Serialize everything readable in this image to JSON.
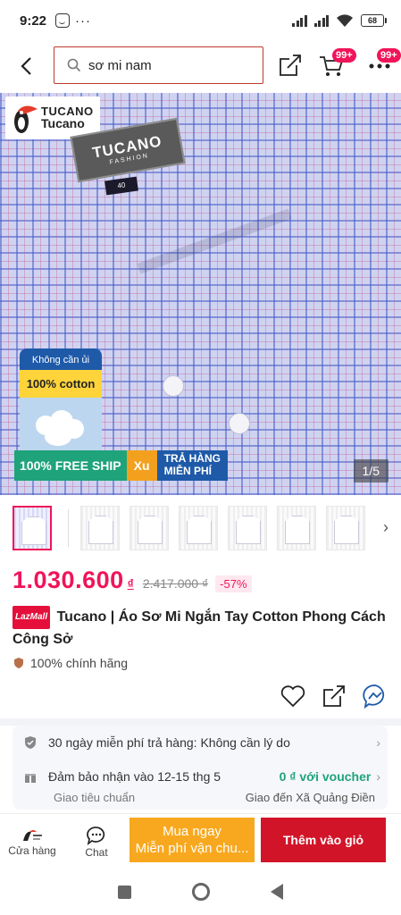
{
  "status": {
    "time": "9:22",
    "more": "···",
    "battery": "68"
  },
  "header": {
    "search_value": "sơ mi nam",
    "cart_badge": "99+",
    "more_badge": "99+"
  },
  "gallery": {
    "brand_name": "TUCANO",
    "brand_sub": "Tucano",
    "collar_label": "TUCANO",
    "collar_sub": "FASHION",
    "size_tag": "40",
    "promo_no_iron": "Không cần ủi",
    "promo_cotton": "100% cotton",
    "free_ship": "100% FREE SHIP",
    "xu": "Xu",
    "return_line1": "TRẢ HÀNG",
    "return_line2": "MIỄN PHÍ",
    "counter": "1/5",
    "thumb_next": "›"
  },
  "product": {
    "price": "1.030.600",
    "currency": "₫",
    "old_price": "2.417.000 ₫",
    "discount": "-57%",
    "mall_badge": "LazMall",
    "title": "Tucano | Áo Sơ Mi Ngắn Tay Cotton Phong Cách Công Sở",
    "authentic": "100% chính hãng"
  },
  "info": {
    "return_text": "30 ngày miễn phí trả hàng: Không cần lý do",
    "delivery_text": "Đảm bảo nhận vào 12-15 thg 5",
    "voucher_text": "0 ₫ với voucher",
    "standard": "Giao tiêu chuẩn",
    "deliver_to": "Giao đến Xã Quảng Điền",
    "chevron": "›"
  },
  "bottom": {
    "store_label": "Cửa hàng",
    "chat_label": "Chat",
    "buy_line1": "Mua ngay",
    "buy_line2": "Miễn phí vận chu...",
    "add_cart": "Thêm vào giỏ"
  },
  "colors": {
    "accent": "#f0145a",
    "cart_button": "#d21428",
    "buy_button": "#f8a81f",
    "voucher": "#1fa37a"
  }
}
